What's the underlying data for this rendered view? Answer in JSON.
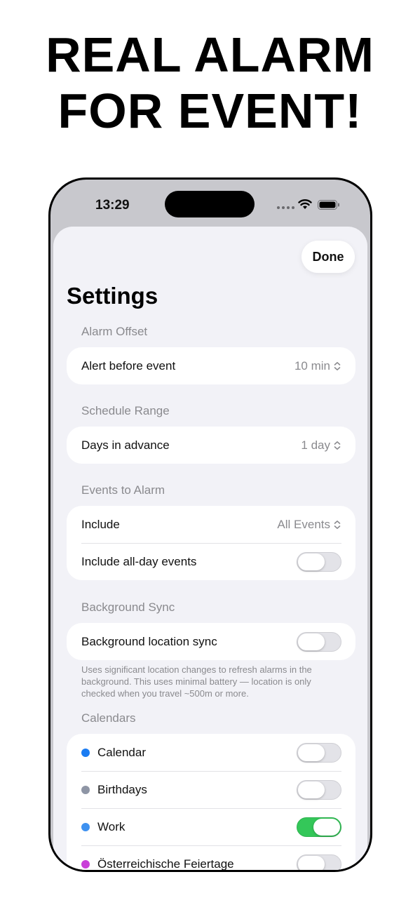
{
  "headline": {
    "line1": "REAL ALARM",
    "line2": "FOR EVENT!"
  },
  "status_bar": {
    "time": "13:29"
  },
  "sheet": {
    "done_label": "Done",
    "title": "Settings",
    "alarm_offset": {
      "header": "Alarm Offset",
      "alert_label": "Alert before event",
      "alert_value": "10 min"
    },
    "schedule_range": {
      "header": "Schedule Range",
      "days_label": "Days in advance",
      "days_value": "1 day"
    },
    "events_to_alarm": {
      "header": "Events to Alarm",
      "include_label": "Include",
      "include_value": "All Events",
      "all_day_label": "Include all-day events",
      "all_day_on": false
    },
    "background_sync": {
      "header": "Background Sync",
      "location_label": "Background location sync",
      "location_on": false,
      "footnote": "Uses significant location changes to refresh alarms in the background. This uses minimal battery — location is only checked when you travel ~500m or more."
    },
    "calendars": {
      "header": "Calendars",
      "items": [
        {
          "label": "Calendar",
          "color": "#1a7cf2",
          "on": false
        },
        {
          "label": "Birthdays",
          "color": "#8e95a5",
          "on": false
        },
        {
          "label": "Work",
          "color": "#3e91f0",
          "on": true
        },
        {
          "label": "Österreichische Feiertage",
          "color": "#c93fd8",
          "on": false
        }
      ]
    }
  },
  "colors": {
    "toggle_on": "#34c759",
    "background": "#f2f2f7"
  }
}
